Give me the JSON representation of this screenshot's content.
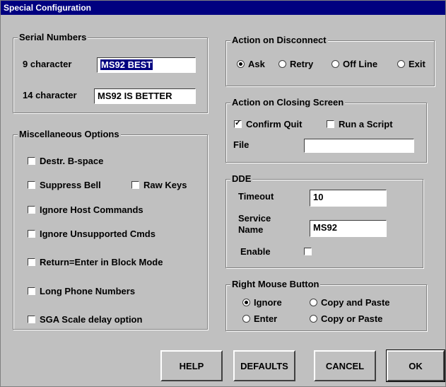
{
  "window": {
    "title": "Special Configuration"
  },
  "serial": {
    "legend": "Serial Numbers",
    "nine_label": "9 character",
    "nine_value": "MS92 BEST",
    "fourteen_label": "14 character",
    "fourteen_value": "MS92 IS BETTER"
  },
  "misc": {
    "legend": "Miscellaneous Options",
    "destr": "Destr. B-space",
    "suppress": "Suppress Bell",
    "raw": "Raw Keys",
    "ignore_host": "Ignore Host Commands",
    "ignore_unsup": "Ignore Unsupported Cmds",
    "return_enter": "Return=Enter in Block Mode",
    "long_phone": "Long Phone Numbers",
    "sga": "SGA Scale delay option"
  },
  "disconnect": {
    "legend": "Action on Disconnect",
    "ask": "Ask",
    "retry": "Retry",
    "offline": "Off Line",
    "exit": "Exit",
    "selected": "ask"
  },
  "closing": {
    "legend": "Action on Closing Screen",
    "confirm": "Confirm Quit",
    "script": "Run a Script",
    "file_label": "File",
    "file_value": ""
  },
  "dde": {
    "legend": "DDE",
    "timeout_label": "Timeout",
    "timeout_value": "10",
    "service_label_1": "Service",
    "service_label_2": "Name",
    "service_value": "MS92",
    "enable_label": "Enable"
  },
  "mouse": {
    "legend": "Right Mouse Button",
    "ignore": "Ignore",
    "enter": "Enter",
    "copy_paste": "Copy and Paste",
    "copy_or_paste": "Copy or Paste",
    "selected": "ignore"
  },
  "buttons": {
    "help": "HELP",
    "defaults": "DEFAULTS",
    "cancel": "CANCEL",
    "ok": "OK"
  }
}
